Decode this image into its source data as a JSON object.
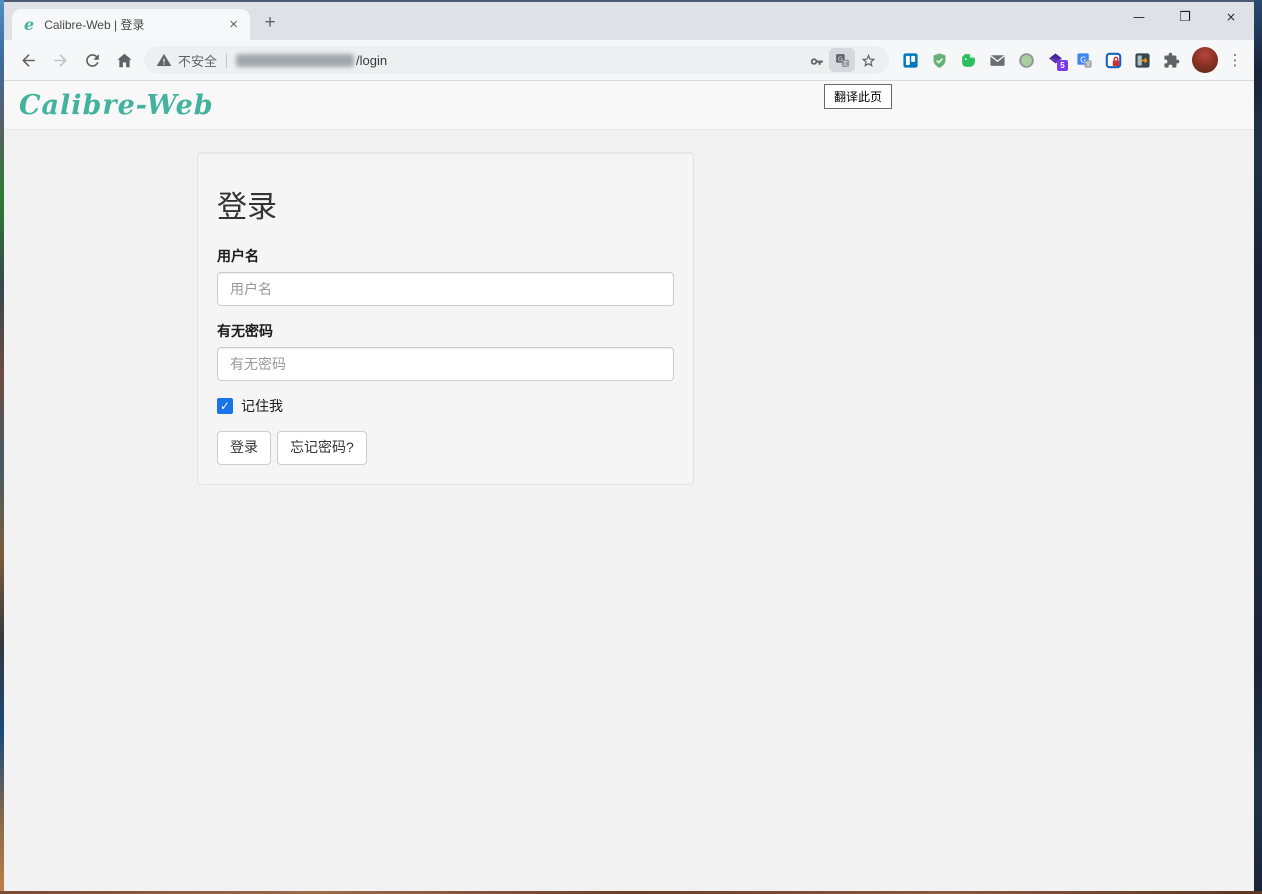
{
  "browser": {
    "tab": {
      "favicon_letter": "e",
      "title": "Calibre-Web | 登录",
      "close_glyph": "×"
    },
    "new_tab_glyph": "+",
    "window_controls": {
      "minimize": "—",
      "maximize": "❒",
      "close": "×"
    },
    "address": {
      "security_text": "不安全",
      "url_redacted": true,
      "url_suffix": "/login"
    },
    "extensions": {
      "purple_badge": "5"
    },
    "menu_glyph": "⋮"
  },
  "page": {
    "brand": "Calibre-Web",
    "translate_tooltip": "翻译此页",
    "login": {
      "heading": "登录",
      "username_label": "用户名",
      "username_placeholder": "用户名",
      "username_value": "",
      "password_label": "有无密码",
      "password_placeholder": "有无密码",
      "password_value": "",
      "remember_me_label": "记住我",
      "remember_me_checked": true,
      "check_glyph": "✓",
      "login_button": "登录",
      "forgot_button": "忘记密码?"
    },
    "colors": {
      "brand": "#45b29d",
      "checkbox": "#1a73e8",
      "panel_bg": "#f5f5f5",
      "page_bg": "#f2f2f2",
      "navbar_bg": "#f8f8f8"
    }
  }
}
